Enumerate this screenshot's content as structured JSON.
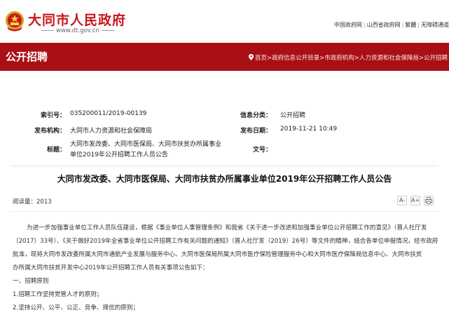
{
  "header": {
    "site_title": "大同市人民政府",
    "site_url": "www.dt.gov.cn",
    "top_links": [
      "中国政府网",
      "山西省政府网",
      "繁體",
      "无障碍通道"
    ]
  },
  "section": {
    "title": "公开招聘",
    "breadcrumb": "首页>政府信息公开目录>市政府机构>人力资源和社会保障局>公开招聘"
  },
  "meta": {
    "index_label": "索引号：",
    "index_value": "035200011/2019-00139",
    "category_label": "信息分类：",
    "category_value": "公开招聘",
    "org_label": "发布机构：",
    "org_value": "大同市人力资源和社会保障局",
    "date_label": "发布日期：",
    "date_value": "2019-11-21 10:49",
    "subject_label": "标题：",
    "subject_line1": "大同市发改委、大同市医保局、大同市扶贫办所属事业",
    "subject_line2": "单位2019年公开招聘工作人员公告",
    "docno_label": "文号："
  },
  "article": {
    "title": "大同市发改委、大同市医保局、大同市扶贫办所属事业单位2019年公开招聘工作人员公告",
    "read_count": "阅读量：2013",
    "tools": [
      "A-",
      "A+",
      "print-icon"
    ],
    "paragraphs": [
      "为进一步加强事业单位工作人员队伍建设，根据《事业单位人事管理条例》和我省《关于进一步改进和加强事业单位公开招聘工作的意见》（晋人社厅发",
      "（2017）33号）、《关于做好2019年全省事业单位公开招聘工作有关问题的通知》（晋人社厅发（2019）26号）等文件的精神，结合各单位申报情况，经市政府",
      "批准，现将大同市发改委所属大同市通航产业发展与服务中心、大同市医保局所属大同市医疗保险管理服务中心和大同市医疗保障局信息中心、大同市扶贫",
      "办所属大同市扶贫开发中心2019年公开招聘工作人员有关事项公告如下：",
      "一、招聘原则",
      "1.招聘工作坚持党管人才的原则；",
      "2.坚持公开、公平、公正、竞争、择优的原则；"
    ]
  },
  "colors": {
    "brand_red": "#c8161d",
    "bar_red": "#a81016"
  }
}
